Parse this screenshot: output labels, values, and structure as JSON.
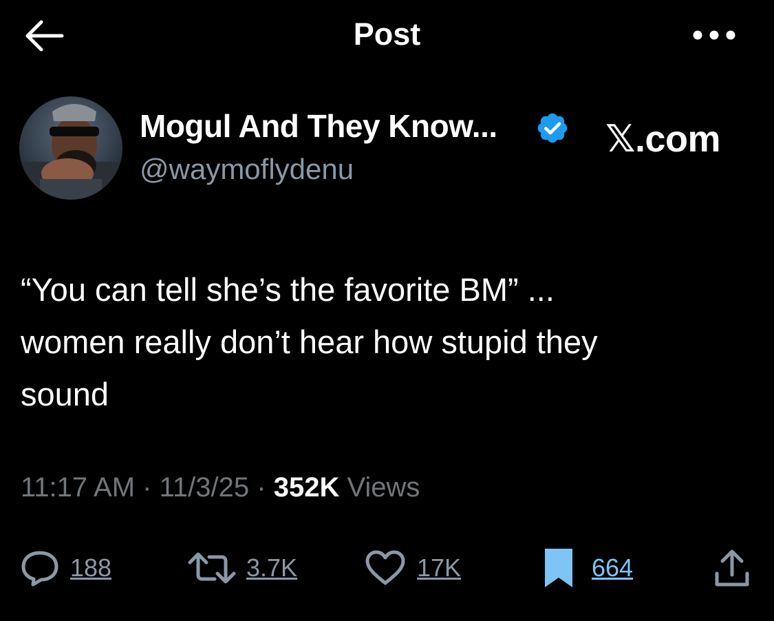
{
  "header": {
    "title": "Post",
    "back_icon": "arrow-left-icon",
    "more_icon": "ellipsis-icon"
  },
  "author": {
    "display_name": "Mogul And They Know...",
    "handle": "@waymoflydenu",
    "verified": true,
    "verified_color": "#1d9bf0",
    "site_label": "𝕏.com"
  },
  "tweet": {
    "lines": [
      "“You can tell she’s the favorite BM” ...",
      "women really don’t hear how stupid they",
      "sound"
    ]
  },
  "meta": {
    "time": "11:17 AM",
    "date": "11/3/25",
    "separator": "·",
    "views_count": "352K",
    "views_label": "Views"
  },
  "actions": {
    "replies": "188",
    "reposts": "3.7K",
    "likes": "17K",
    "bookmarks": "664",
    "bookmark_color": "#7ec4f7"
  }
}
